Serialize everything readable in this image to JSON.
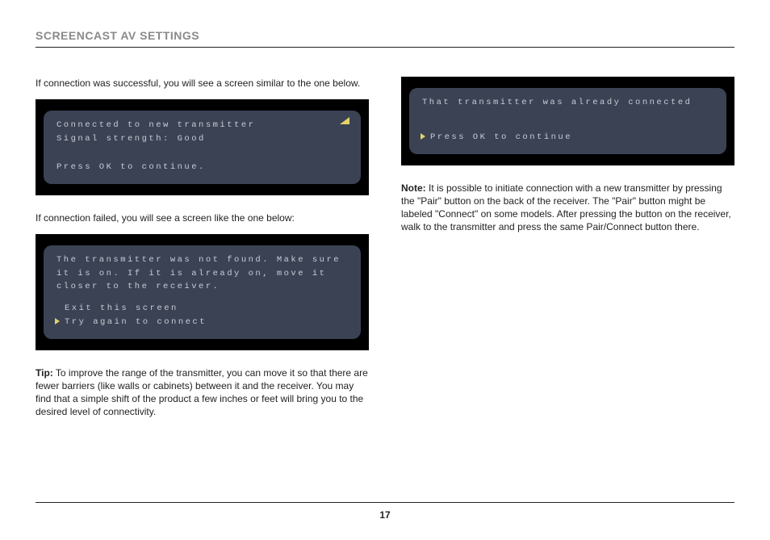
{
  "header": {
    "title": "SCREENCAST AV SETTINGS"
  },
  "left": {
    "intro_success": "If connection was successful, you will see a screen similar to the one below.",
    "screen_success": {
      "line1": "Connected to new transmitter",
      "line2": "Signal strength: Good",
      "prompt": "Press OK to continue."
    },
    "intro_fail": "If connection failed, you will see a screen like the one below:",
    "screen_fail": {
      "msg": "The transmitter was not found. Make sure it is on. If it is already on, move it closer to the receiver.",
      "opt1": "Exit this screen",
      "opt2": "Try again to connect"
    },
    "tip_label": "Tip:",
    "tip_body": " To improve the range of the transmitter, you can move it so that there are fewer barriers (like walls or cabinets) between it and the receiver. You may find that a simple shift of the product a few inches or feet will bring you to the desired level of connectivity."
  },
  "right": {
    "screen_already": {
      "line1": "That transmitter was already connected",
      "prompt": "Press OK to continue"
    },
    "note_label": "Note:",
    "note_body": " It is possible to initiate connection with a new transmitter by pressing the \"Pair\" button on the back of the receiver. The \"Pair\" button might be labeled \"Connect\" on some models. After pressing the button on the receiver, walk to the transmitter and press the same Pair/Connect button there."
  },
  "footer": {
    "page": "17"
  }
}
